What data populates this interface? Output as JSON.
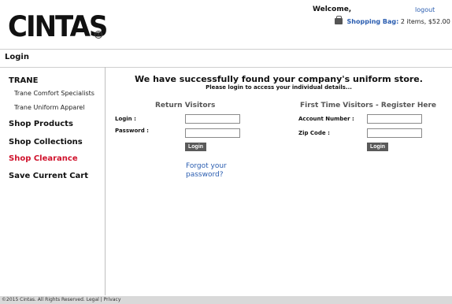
{
  "header": {
    "logo": "CINTAS",
    "welcome": "Welcome,",
    "logout": "logout",
    "bag_label": "Shopping Bag:",
    "bag_summary": "2 items, $52.00"
  },
  "page_title": "Login",
  "sidebar": {
    "company": "TRANE",
    "sub_items": [
      "Trane Comfort Specialists",
      "Trane Uniform Apparel"
    ],
    "items": [
      "Shop Products",
      "Shop Collections",
      "Shop Clearance",
      "Save Current Cart"
    ]
  },
  "main": {
    "headline": "We have successfully found your company's uniform store.",
    "subline": "Please login to access your individual details...",
    "return_visitors": {
      "title": "Return Visitors",
      "login_label": "Login :",
      "password_label": "Password :",
      "button": "Login",
      "forgot": "Forgot your password?"
    },
    "first_time": {
      "title": "First Time Visitors - Register Here",
      "account_label": "Account Number :",
      "zip_label": "Zip Code :",
      "button": "Login"
    }
  },
  "footer": {
    "text": "©2015 Cintas. All Rights Reserved. Legal | Privacy"
  },
  "colors": {
    "link": "#2a5db0",
    "clearance": "#d0122c",
    "button": "#5a5a5a"
  }
}
